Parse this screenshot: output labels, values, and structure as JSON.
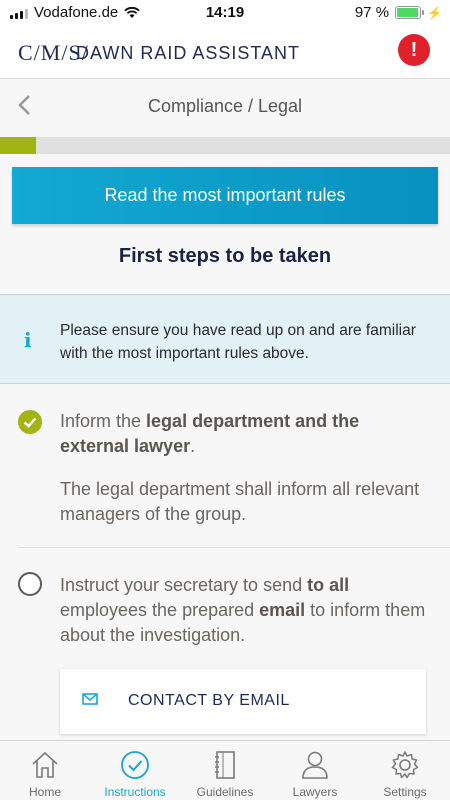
{
  "status_bar": {
    "carrier": "Vodafone.de",
    "time": "14:19",
    "battery": "97 %",
    "battery_level": 0.97
  },
  "app": {
    "logo": "C/M/S/",
    "title": "DAWN RAID ASSISTANT",
    "alert_label": "!"
  },
  "nav": {
    "title": "Compliance / Legal"
  },
  "progress": {
    "value": 0.08
  },
  "cta": {
    "label": "Read the most important rules"
  },
  "section": {
    "title": "First steps to be taken"
  },
  "info": {
    "icon": "info-icon",
    "text": "Please ensure you have read up on and are familiar with the most important rules above."
  },
  "steps": [
    {
      "done": true,
      "text_before": "Inform the ",
      "text_bold": "legal department and the external lawyer",
      "text_after": ".",
      "sub": "The legal department shall inform all relevant managers of the group."
    },
    {
      "done": false,
      "text_1": "Instruct your secretary to send ",
      "bold_1": "to all",
      "text_2": " employees the prepared ",
      "bold_2": "email",
      "text_3": " to inform them about the investigation."
    }
  ],
  "contact": {
    "label": "CONTACT BY EMAIL",
    "icon": "envelope-icon"
  },
  "tabs": [
    {
      "label": "Home",
      "icon": "home-icon",
      "active": false
    },
    {
      "label": "Instructions",
      "icon": "check-circle-icon",
      "active": true
    },
    {
      "label": "Guidelines",
      "icon": "notebook-icon",
      "active": false
    },
    {
      "label": "Lawyers",
      "icon": "person-icon",
      "active": false
    },
    {
      "label": "Settings",
      "icon": "gear-icon",
      "active": false
    }
  ],
  "colors": {
    "accent": "#1aa6cf",
    "brand_navy": "#1f2a5a",
    "progress_green": "#a2b413",
    "alert_red": "#e0202a"
  }
}
